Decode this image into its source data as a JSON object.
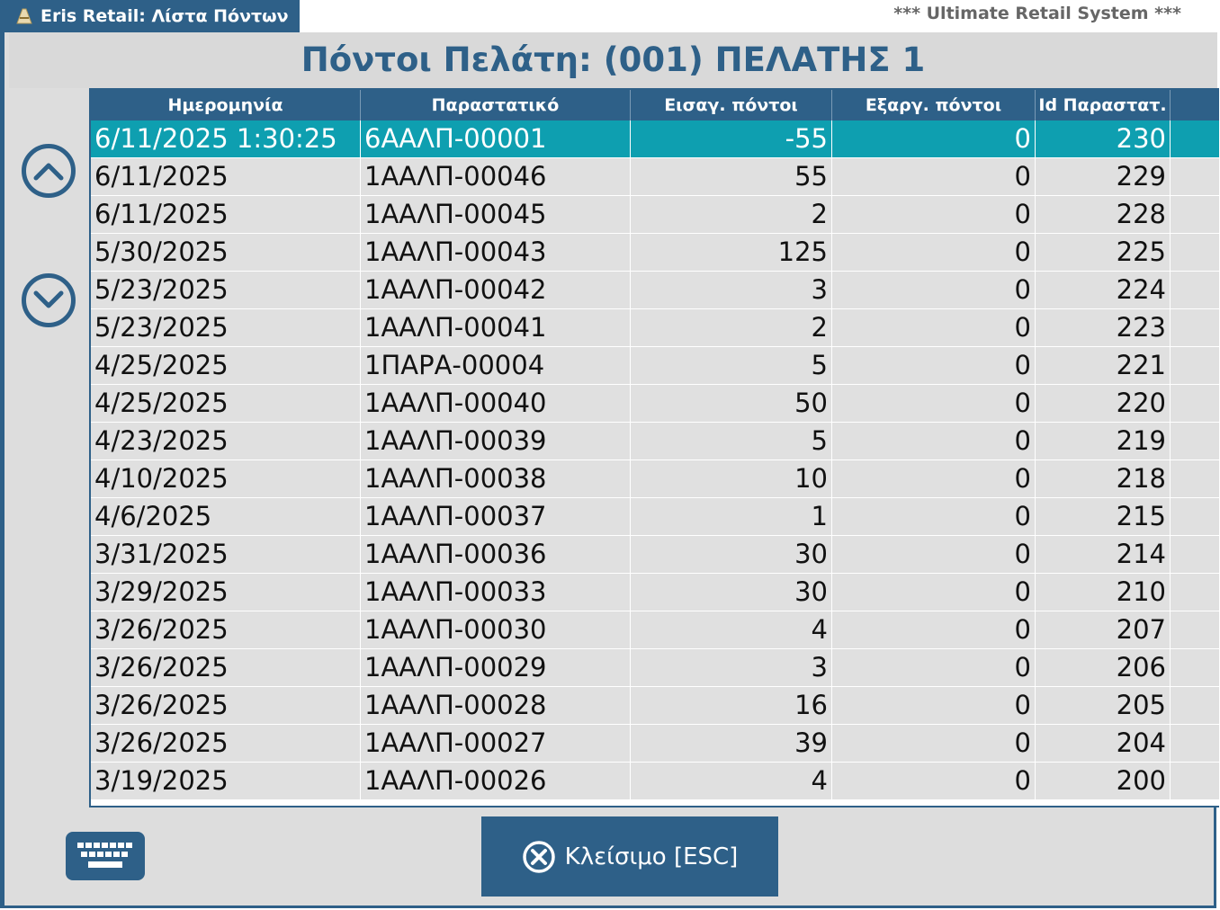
{
  "window": {
    "title": "Eris Retail: Λίστα Πόντων",
    "system_label": "*** Ultimate Retail System ***"
  },
  "heading": "Πόντοι Πελάτη: (001) ΠΕΛΑΤΗΣ 1",
  "grid": {
    "columns": [
      "Ημερομηνία",
      "Παραστατικό",
      "Εισαγ. πόντοι",
      "Εξαργ. πόντοι",
      "Id Παραστατ.",
      ""
    ],
    "selected_row": 0,
    "rows": [
      [
        "6/11/2025 1:30:25",
        "6ΑΑΛΠ-00001",
        "-55",
        "0",
        "230"
      ],
      [
        "6/11/2025",
        "1ΑΑΛΠ-00046",
        "55",
        "0",
        "229"
      ],
      [
        "6/11/2025",
        "1ΑΑΛΠ-00045",
        "2",
        "0",
        "228"
      ],
      [
        "5/30/2025",
        "1ΑΑΛΠ-00043",
        "125",
        "0",
        "225"
      ],
      [
        "5/23/2025",
        "1ΑΑΛΠ-00042",
        "3",
        "0",
        "224"
      ],
      [
        "5/23/2025",
        "1ΑΑΛΠ-00041",
        "2",
        "0",
        "223"
      ],
      [
        "4/25/2025",
        "1ΠΑΡΑ-00004",
        "5",
        "0",
        "221"
      ],
      [
        "4/25/2025",
        "1ΑΑΛΠ-00040",
        "50",
        "0",
        "220"
      ],
      [
        "4/23/2025",
        "1ΑΑΛΠ-00039",
        "5",
        "0",
        "219"
      ],
      [
        "4/10/2025",
        "1ΑΑΛΠ-00038",
        "10",
        "0",
        "218"
      ],
      [
        "4/6/2025",
        "1ΑΑΛΠ-00037",
        "1",
        "0",
        "215"
      ],
      [
        "3/31/2025",
        "1ΑΑΛΠ-00036",
        "30",
        "0",
        "214"
      ],
      [
        "3/29/2025",
        "1ΑΑΛΠ-00033",
        "30",
        "0",
        "210"
      ],
      [
        "3/26/2025",
        "1ΑΑΛΠ-00030",
        "4",
        "0",
        "207"
      ],
      [
        "3/26/2025",
        "1ΑΑΛΠ-00029",
        "3",
        "0",
        "206"
      ],
      [
        "3/26/2025",
        "1ΑΑΛΠ-00028",
        "16",
        "0",
        "205"
      ],
      [
        "3/26/2025",
        "1ΑΑΛΠ-00027",
        "39",
        "0",
        "204"
      ],
      [
        "3/19/2025",
        "1ΑΑΛΠ-00026",
        "4",
        "0",
        "200"
      ]
    ]
  },
  "buttons": {
    "close_label": "Κλείσιμο [ESC]",
    "scroll_up_icon": "chevron-up-icon",
    "scroll_down_icon": "chevron-down-icon",
    "keyboard_icon": "keyboard-icon"
  },
  "colors": {
    "primary": "#2e6088",
    "selected_row": "#0e9fb0",
    "row_bg": "#e0e0e0"
  }
}
